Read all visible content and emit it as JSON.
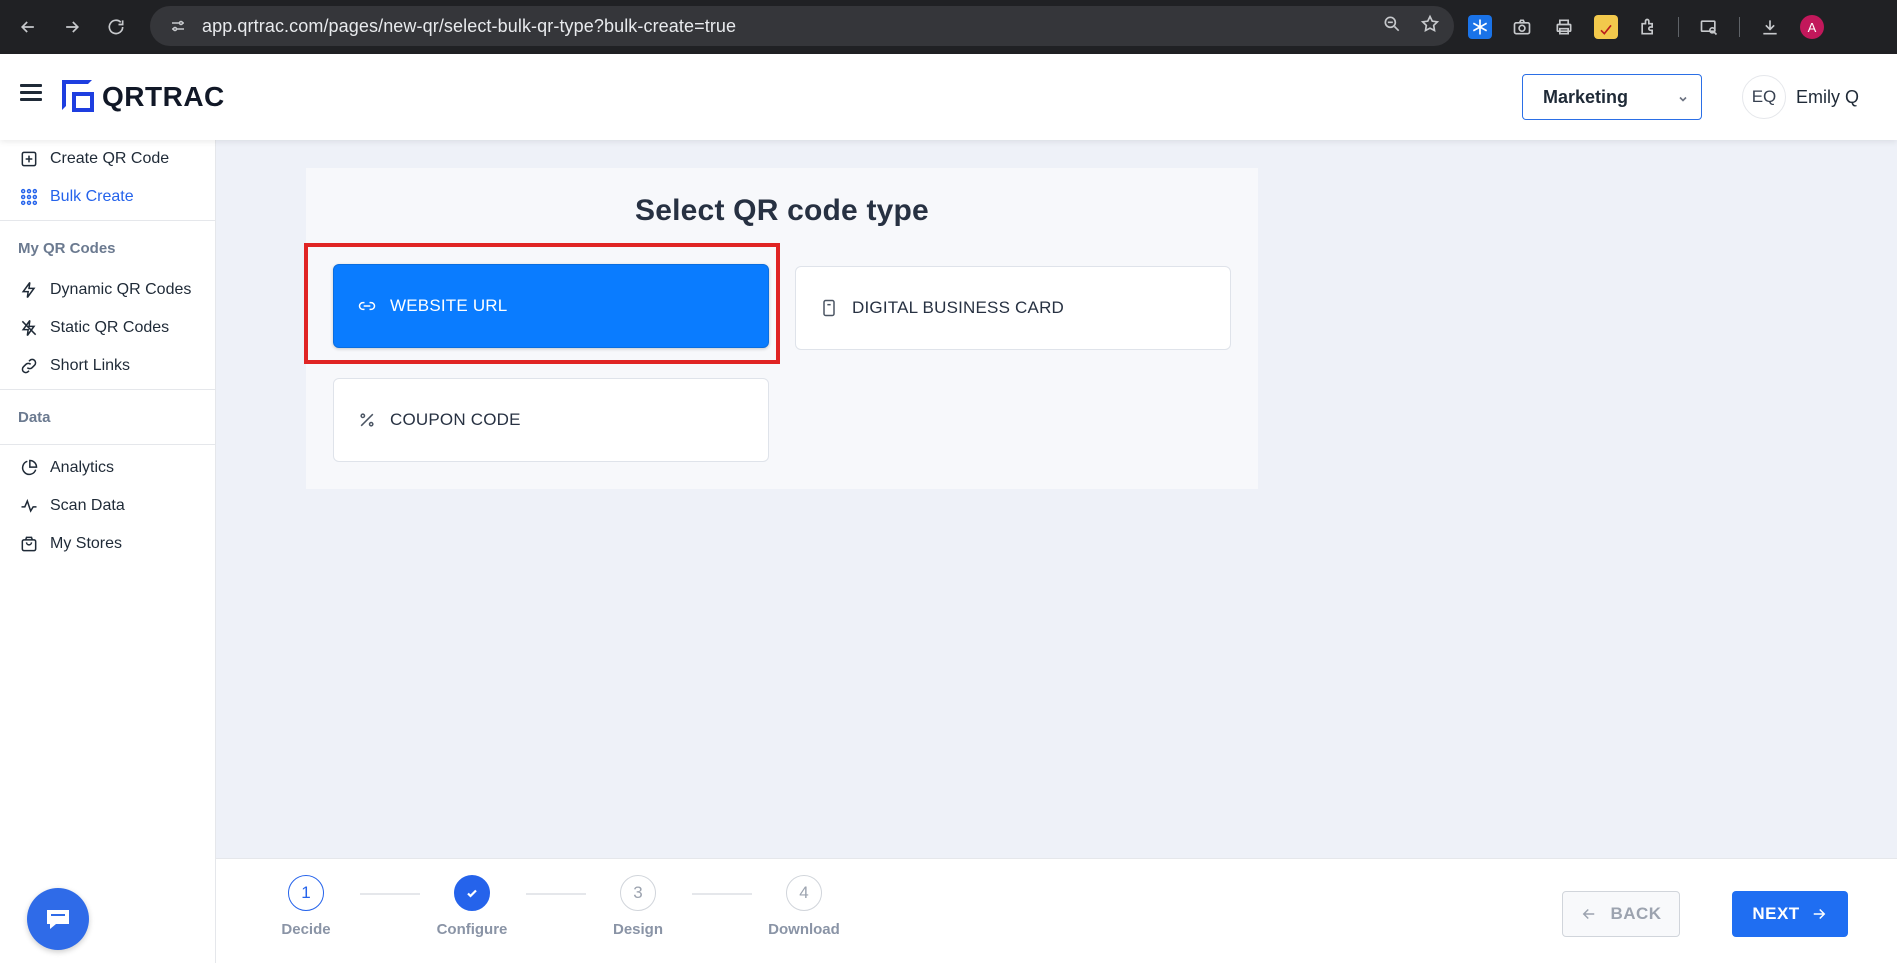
{
  "browser": {
    "url": "app.qrtrac.com/pages/new-qr/select-bulk-qr-type?bulk-create=true",
    "profile_initial": "A"
  },
  "header": {
    "logo_text": "QRTRAC",
    "org_select_value": "Marketing",
    "user_initials": "EQ",
    "user_name": "Emily Q"
  },
  "sidebar": {
    "items_top": [
      {
        "label": "Create QR Code",
        "icon": "plus-square-icon"
      },
      {
        "label": "Bulk Create",
        "icon": "grid-dots-icon",
        "active": true
      }
    ],
    "section_my_qr": "My QR Codes",
    "items_qr": [
      {
        "label": "Dynamic QR Codes",
        "icon": "lightning-icon"
      },
      {
        "label": "Static QR Codes",
        "icon": "lightning-off-icon"
      },
      {
        "label": "Short Links",
        "icon": "link-icon"
      }
    ],
    "section_data": "Data",
    "items_data": [
      {
        "label": "Analytics",
        "icon": "pie-chart-icon"
      },
      {
        "label": "Scan Data",
        "icon": "activity-icon"
      },
      {
        "label": "My Stores",
        "icon": "shopping-bag-icon"
      }
    ]
  },
  "main": {
    "title": "Select QR code type",
    "cards": [
      {
        "label": "WEBSITE URL",
        "icon": "link-icon",
        "selected": true
      },
      {
        "label": "DIGITAL BUSINESS CARD",
        "icon": "card-icon",
        "selected": false
      },
      {
        "label": "COUPON CODE",
        "icon": "percent-icon",
        "selected": false
      }
    ]
  },
  "stepper": {
    "steps": [
      {
        "number": "1",
        "label": "Decide",
        "state": "current"
      },
      {
        "number": "2",
        "label": "Configure",
        "state": "done"
      },
      {
        "number": "3",
        "label": "Design",
        "state": "pending"
      },
      {
        "number": "4",
        "label": "Download",
        "state": "pending"
      }
    ],
    "back_label": "BACK",
    "next_label": "NEXT"
  },
  "colors": {
    "accent": "#2563eb",
    "selected_card": "#0a7cff",
    "highlight": "#e02424"
  }
}
